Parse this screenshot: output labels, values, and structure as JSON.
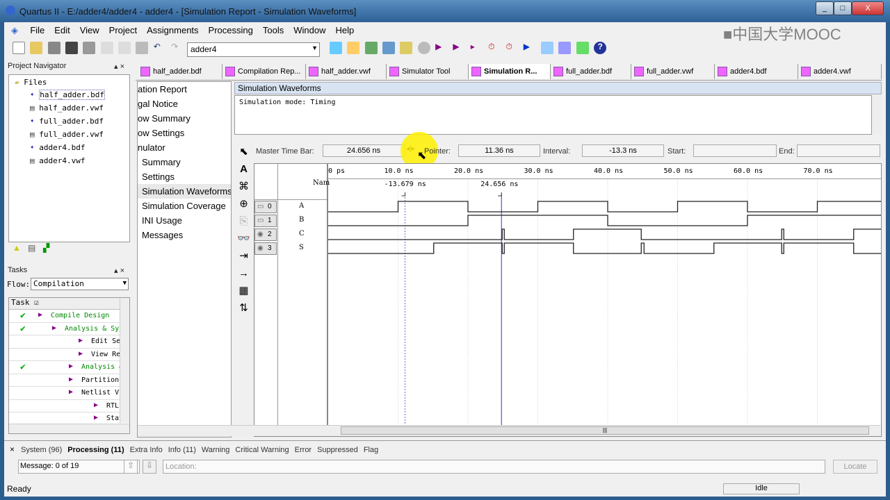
{
  "window": {
    "title": "Quartus II - E:/adder4/adder4 - adder4 - [Simulation Report - Simulation Waveforms]",
    "watermark": "中国大学MOOC"
  },
  "menu": [
    "File",
    "Edit",
    "View",
    "Project",
    "Assignments",
    "Processing",
    "Tools",
    "Window",
    "Help"
  ],
  "toolbar": {
    "project_select": "adder4"
  },
  "project_navigator": {
    "title": "Project Navigator",
    "root": "Files",
    "files": [
      "half_adder.bdf",
      "half_adder.vwf",
      "full_adder.bdf",
      "full_adder.vwf",
      "adder4.bdf",
      "adder4.vwf"
    ],
    "selected": 0
  },
  "tasks": {
    "title": "Tasks",
    "flow_label": "Flow:",
    "flow_value": "Compilation",
    "column": "Task",
    "items": [
      {
        "label": "Compile Design",
        "done": true,
        "green": true
      },
      {
        "label": "Analysis & Synthesis",
        "done": true,
        "green": true
      },
      {
        "label": "Edit Settings",
        "done": false,
        "green": false
      },
      {
        "label": "View Report",
        "done": false,
        "green": false
      },
      {
        "label": "Analysis & Elaboration",
        "done": true,
        "green": true
      },
      {
        "label": "Partition Merge",
        "done": false,
        "green": false
      },
      {
        "label": "Netlist Viewers",
        "done": false,
        "green": false
      },
      {
        "label": "RTL Viewer",
        "done": false,
        "green": false
      },
      {
        "label": "State Machine Viewer",
        "done": false,
        "green": false
      }
    ]
  },
  "doc_tabs": [
    "half_adder.bdf",
    "Compilation Rep...",
    "half_adder.vwf",
    "Simulator Tool",
    "Simulation R...",
    "full_adder.bdf",
    "full_adder.vwf",
    "adder4.bdf",
    "adder4.vwf"
  ],
  "active_doc_tab": 4,
  "report_tree": [
    "ation Report",
    "gal Notice",
    "ow Summary",
    "ow Settings",
    "nulator",
    "Summary",
    "Settings",
    "Simulation Waveforms",
    "Simulation Coverage",
    "INI Usage",
    "Messages"
  ],
  "report_selected": 7,
  "sim": {
    "header": "Simulation Waveforms",
    "mode_text": "Simulation mode: Timing",
    "master_label": "Master Time Bar:",
    "master_value": "24.656 ns",
    "pointer_label": "Pointer:",
    "pointer_value": "11.36 ns",
    "interval_label": "Interval:",
    "interval_value": "-13.3 ns",
    "start_label": "Start:",
    "start_value": "",
    "end_label": "End:",
    "end_value": "",
    "name_header": "Nam",
    "ticks": [
      "0 ps",
      "10.0 ns",
      "20.0 ns",
      "30.0 ns",
      "40.0 ns",
      "50.0 ns",
      "60.0 ns",
      "70.0 ns"
    ],
    "cursor_labels": [
      {
        "text": "-13.679 ns",
        "t": 11
      },
      {
        "text": "24.656 ns",
        "t": 24.8
      }
    ],
    "signals": [
      {
        "id": "0",
        "name": "A",
        "kind": "input",
        "init": 0,
        "edges": [
          10,
          20,
          30,
          40,
          50,
          60,
          70
        ]
      },
      {
        "id": "1",
        "name": "B",
        "kind": "input",
        "init": 0,
        "edges": [
          20,
          40,
          60
        ]
      },
      {
        "id": "2",
        "name": "C",
        "kind": "output",
        "init": 0,
        "edges": [
          24.9,
          25.2,
          35.1,
          44.8,
          64.9,
          65.2,
          75.2
        ]
      },
      {
        "id": "3",
        "name": "S",
        "kind": "output",
        "init": 0,
        "edges": [
          15.1,
          24.9,
          25.2,
          35.1,
          44.8,
          45.2,
          55.2,
          64.9,
          65.2,
          75.2
        ]
      }
    ]
  },
  "messages": {
    "tabs": [
      "System (96)",
      "Processing (11)",
      "Extra Info",
      "Info (11)",
      "Warning",
      "Critical Warning",
      "Error",
      "Suppressed",
      "Flag"
    ],
    "active": 1,
    "message_count": "Message: 0 of 19",
    "location_placeholder": "Location:",
    "locate": "Locate"
  },
  "status": {
    "left": "Ready",
    "state": "Idle"
  }
}
